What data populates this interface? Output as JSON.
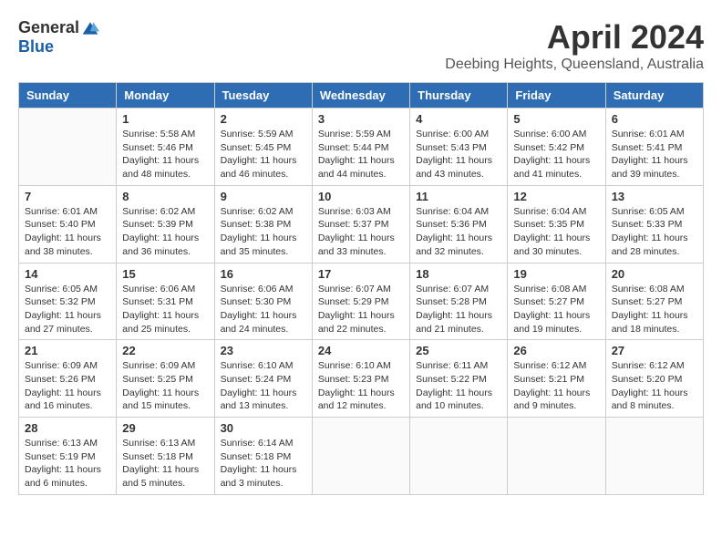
{
  "logo": {
    "general": "General",
    "blue": "Blue"
  },
  "title": "April 2024",
  "location": "Deebing Heights, Queensland, Australia",
  "headers": [
    "Sunday",
    "Monday",
    "Tuesday",
    "Wednesday",
    "Thursday",
    "Friday",
    "Saturday"
  ],
  "weeks": [
    [
      {
        "day": "",
        "info": ""
      },
      {
        "day": "1",
        "info": "Sunrise: 5:58 AM\nSunset: 5:46 PM\nDaylight: 11 hours\nand 48 minutes."
      },
      {
        "day": "2",
        "info": "Sunrise: 5:59 AM\nSunset: 5:45 PM\nDaylight: 11 hours\nand 46 minutes."
      },
      {
        "day": "3",
        "info": "Sunrise: 5:59 AM\nSunset: 5:44 PM\nDaylight: 11 hours\nand 44 minutes."
      },
      {
        "day": "4",
        "info": "Sunrise: 6:00 AM\nSunset: 5:43 PM\nDaylight: 11 hours\nand 43 minutes."
      },
      {
        "day": "5",
        "info": "Sunrise: 6:00 AM\nSunset: 5:42 PM\nDaylight: 11 hours\nand 41 minutes."
      },
      {
        "day": "6",
        "info": "Sunrise: 6:01 AM\nSunset: 5:41 PM\nDaylight: 11 hours\nand 39 minutes."
      }
    ],
    [
      {
        "day": "7",
        "info": "Sunrise: 6:01 AM\nSunset: 5:40 PM\nDaylight: 11 hours\nand 38 minutes."
      },
      {
        "day": "8",
        "info": "Sunrise: 6:02 AM\nSunset: 5:39 PM\nDaylight: 11 hours\nand 36 minutes."
      },
      {
        "day": "9",
        "info": "Sunrise: 6:02 AM\nSunset: 5:38 PM\nDaylight: 11 hours\nand 35 minutes."
      },
      {
        "day": "10",
        "info": "Sunrise: 6:03 AM\nSunset: 5:37 PM\nDaylight: 11 hours\nand 33 minutes."
      },
      {
        "day": "11",
        "info": "Sunrise: 6:04 AM\nSunset: 5:36 PM\nDaylight: 11 hours\nand 32 minutes."
      },
      {
        "day": "12",
        "info": "Sunrise: 6:04 AM\nSunset: 5:35 PM\nDaylight: 11 hours\nand 30 minutes."
      },
      {
        "day": "13",
        "info": "Sunrise: 6:05 AM\nSunset: 5:33 PM\nDaylight: 11 hours\nand 28 minutes."
      }
    ],
    [
      {
        "day": "14",
        "info": "Sunrise: 6:05 AM\nSunset: 5:32 PM\nDaylight: 11 hours\nand 27 minutes."
      },
      {
        "day": "15",
        "info": "Sunrise: 6:06 AM\nSunset: 5:31 PM\nDaylight: 11 hours\nand 25 minutes."
      },
      {
        "day": "16",
        "info": "Sunrise: 6:06 AM\nSunset: 5:30 PM\nDaylight: 11 hours\nand 24 minutes."
      },
      {
        "day": "17",
        "info": "Sunrise: 6:07 AM\nSunset: 5:29 PM\nDaylight: 11 hours\nand 22 minutes."
      },
      {
        "day": "18",
        "info": "Sunrise: 6:07 AM\nSunset: 5:28 PM\nDaylight: 11 hours\nand 21 minutes."
      },
      {
        "day": "19",
        "info": "Sunrise: 6:08 AM\nSunset: 5:27 PM\nDaylight: 11 hours\nand 19 minutes."
      },
      {
        "day": "20",
        "info": "Sunrise: 6:08 AM\nSunset: 5:27 PM\nDaylight: 11 hours\nand 18 minutes."
      }
    ],
    [
      {
        "day": "21",
        "info": "Sunrise: 6:09 AM\nSunset: 5:26 PM\nDaylight: 11 hours\nand 16 minutes."
      },
      {
        "day": "22",
        "info": "Sunrise: 6:09 AM\nSunset: 5:25 PM\nDaylight: 11 hours\nand 15 minutes."
      },
      {
        "day": "23",
        "info": "Sunrise: 6:10 AM\nSunset: 5:24 PM\nDaylight: 11 hours\nand 13 minutes."
      },
      {
        "day": "24",
        "info": "Sunrise: 6:10 AM\nSunset: 5:23 PM\nDaylight: 11 hours\nand 12 minutes."
      },
      {
        "day": "25",
        "info": "Sunrise: 6:11 AM\nSunset: 5:22 PM\nDaylight: 11 hours\nand 10 minutes."
      },
      {
        "day": "26",
        "info": "Sunrise: 6:12 AM\nSunset: 5:21 PM\nDaylight: 11 hours\nand 9 minutes."
      },
      {
        "day": "27",
        "info": "Sunrise: 6:12 AM\nSunset: 5:20 PM\nDaylight: 11 hours\nand 8 minutes."
      }
    ],
    [
      {
        "day": "28",
        "info": "Sunrise: 6:13 AM\nSunset: 5:19 PM\nDaylight: 11 hours\nand 6 minutes."
      },
      {
        "day": "29",
        "info": "Sunrise: 6:13 AM\nSunset: 5:18 PM\nDaylight: 11 hours\nand 5 minutes."
      },
      {
        "day": "30",
        "info": "Sunrise: 6:14 AM\nSunset: 5:18 PM\nDaylight: 11 hours\nand 3 minutes."
      },
      {
        "day": "",
        "info": ""
      },
      {
        "day": "",
        "info": ""
      },
      {
        "day": "",
        "info": ""
      },
      {
        "day": "",
        "info": ""
      }
    ]
  ]
}
